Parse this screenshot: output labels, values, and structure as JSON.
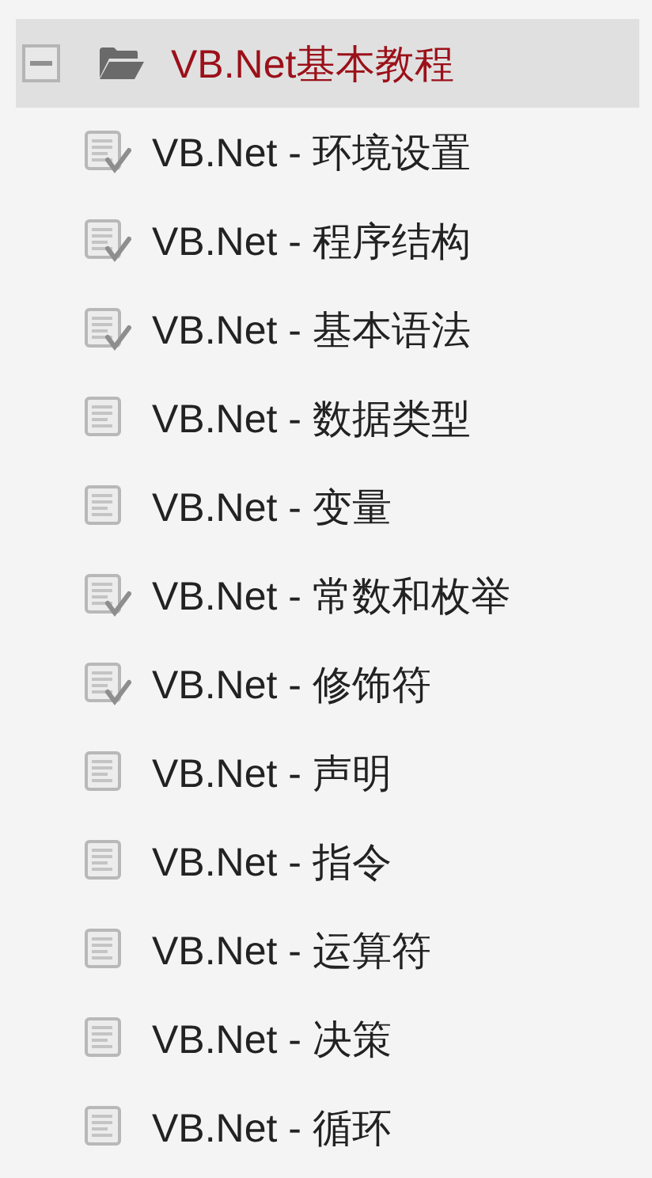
{
  "tree": {
    "label": "VB.Net基本教程",
    "expanded": true,
    "selected": true,
    "children": [
      {
        "label": "VB.Net - 环境设置",
        "done": true,
        "selected": false
      },
      {
        "label": "VB.Net - 程序结构",
        "done": true,
        "selected": false
      },
      {
        "label": "VB.Net - 基本语法",
        "done": true,
        "selected": false
      },
      {
        "label": "VB.Net - 数据类型",
        "done": false,
        "selected": false
      },
      {
        "label": "VB.Net - 变量",
        "done": false,
        "selected": false
      },
      {
        "label": "VB.Net - 常数和枚举",
        "done": true,
        "selected": false
      },
      {
        "label": "VB.Net - 修饰符",
        "done": true,
        "selected": false
      },
      {
        "label": "VB.Net - 声明",
        "done": false,
        "selected": false
      },
      {
        "label": "VB.Net - 指令",
        "done": false,
        "selected": false
      },
      {
        "label": "VB.Net - 运算符",
        "done": false,
        "selected": false
      },
      {
        "label": "VB.Net - 决策",
        "done": false,
        "selected": false
      },
      {
        "label": "VB.Net - 循环",
        "done": false,
        "selected": false
      }
    ]
  }
}
